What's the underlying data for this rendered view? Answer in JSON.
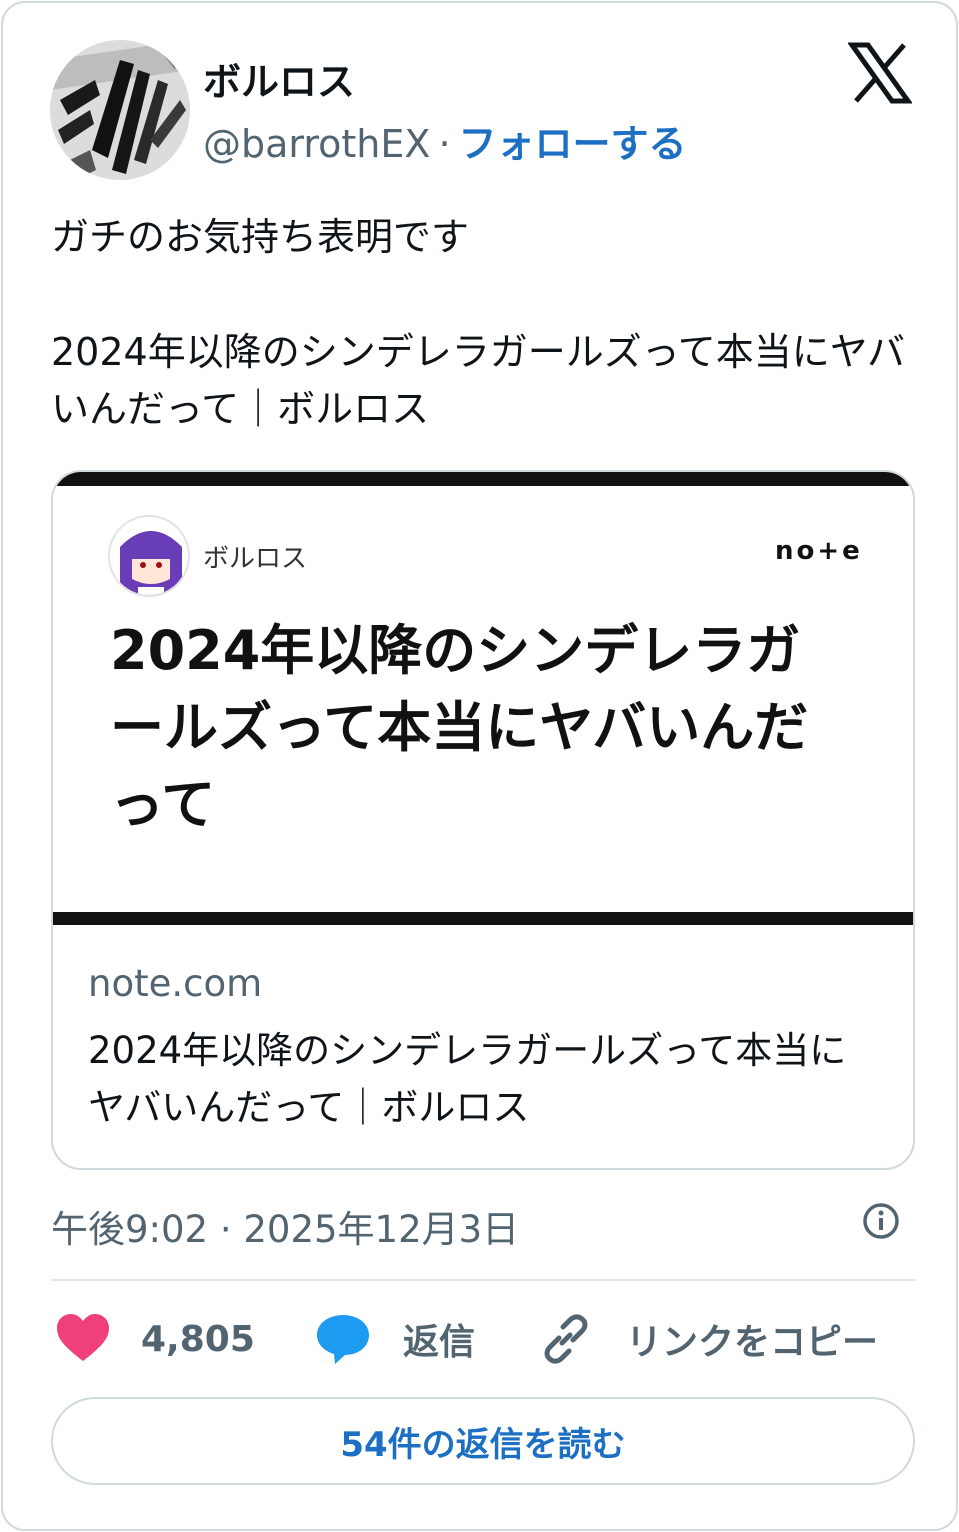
{
  "author": {
    "display_name": "ボルロス",
    "handle": "@barrothEX",
    "separator": "·",
    "follow_label": "フォローする"
  },
  "tweet": {
    "text_line1": "ガチのお気持ち表明です",
    "text_line2": "2024年以降のシンデレラガールズって本当にヤバいんだって｜ボルロス"
  },
  "link_card": {
    "image": {
      "author": "ボルロス",
      "brand": "no+e",
      "headline": "2024年以降のシンデレラガールズって本当にヤバいんだって"
    },
    "domain": "note.com",
    "title": "2024年以降のシンデレラガールズって本当にヤバいんだって｜ボルロス"
  },
  "meta": {
    "timestamp": "午後9:02 · 2025年12月3日"
  },
  "actions": {
    "like_count": "4,805",
    "reply_label": "返信",
    "copy_link_label": "リンクをコピー"
  },
  "read_replies_label": "54件の返信を読む",
  "colors": {
    "accent": "#1d6fc4",
    "like": "#f0407a",
    "reply": "#1d9bf0",
    "secondary_text": "#536471",
    "border": "#cfd9de"
  },
  "icons": {
    "logo": "x-logo-icon",
    "like": "heart-icon",
    "reply": "speech-bubble-icon",
    "copy": "link-icon",
    "info": "info-icon"
  }
}
